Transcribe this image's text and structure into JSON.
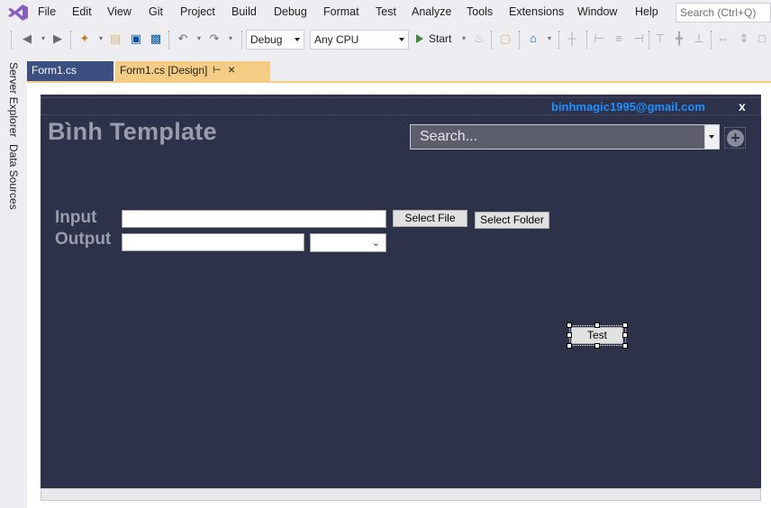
{
  "menu": {
    "items": [
      "File",
      "Edit",
      "View",
      "Git",
      "Project",
      "Build",
      "Debug",
      "Format",
      "Test",
      "Analyze",
      "Tools",
      "Extensions",
      "Window",
      "Help"
    ],
    "search_placeholder": "Search (Ctrl+Q)"
  },
  "toolbar": {
    "configuration": "Debug",
    "platform": "Any CPU",
    "start_label": "Start"
  },
  "sidebar": {
    "tabs": [
      "Server Explorer",
      "Data Sources"
    ]
  },
  "doc_tabs": [
    {
      "label": "Form1.cs",
      "active": false
    },
    {
      "label": "Form1.cs [Design]",
      "active": true
    }
  ],
  "form": {
    "email": "binhmagic1995@gmail.com",
    "close_glyph": "x",
    "title": "Bình Template",
    "search_text": "Search...",
    "plus_glyph": "+",
    "input_label": "Input",
    "output_label": "Output",
    "select_file_label": "Select File",
    "select_folder_label": "Select Folder",
    "test_label": "Test"
  },
  "colors": {
    "form_background": "#2d3149",
    "email_color": "#1e90ff",
    "title_color": "#9b9dac",
    "active_tab": "#f5cc84",
    "inactive_tab": "#3b4f81",
    "vs_purple": "#865fc5"
  }
}
